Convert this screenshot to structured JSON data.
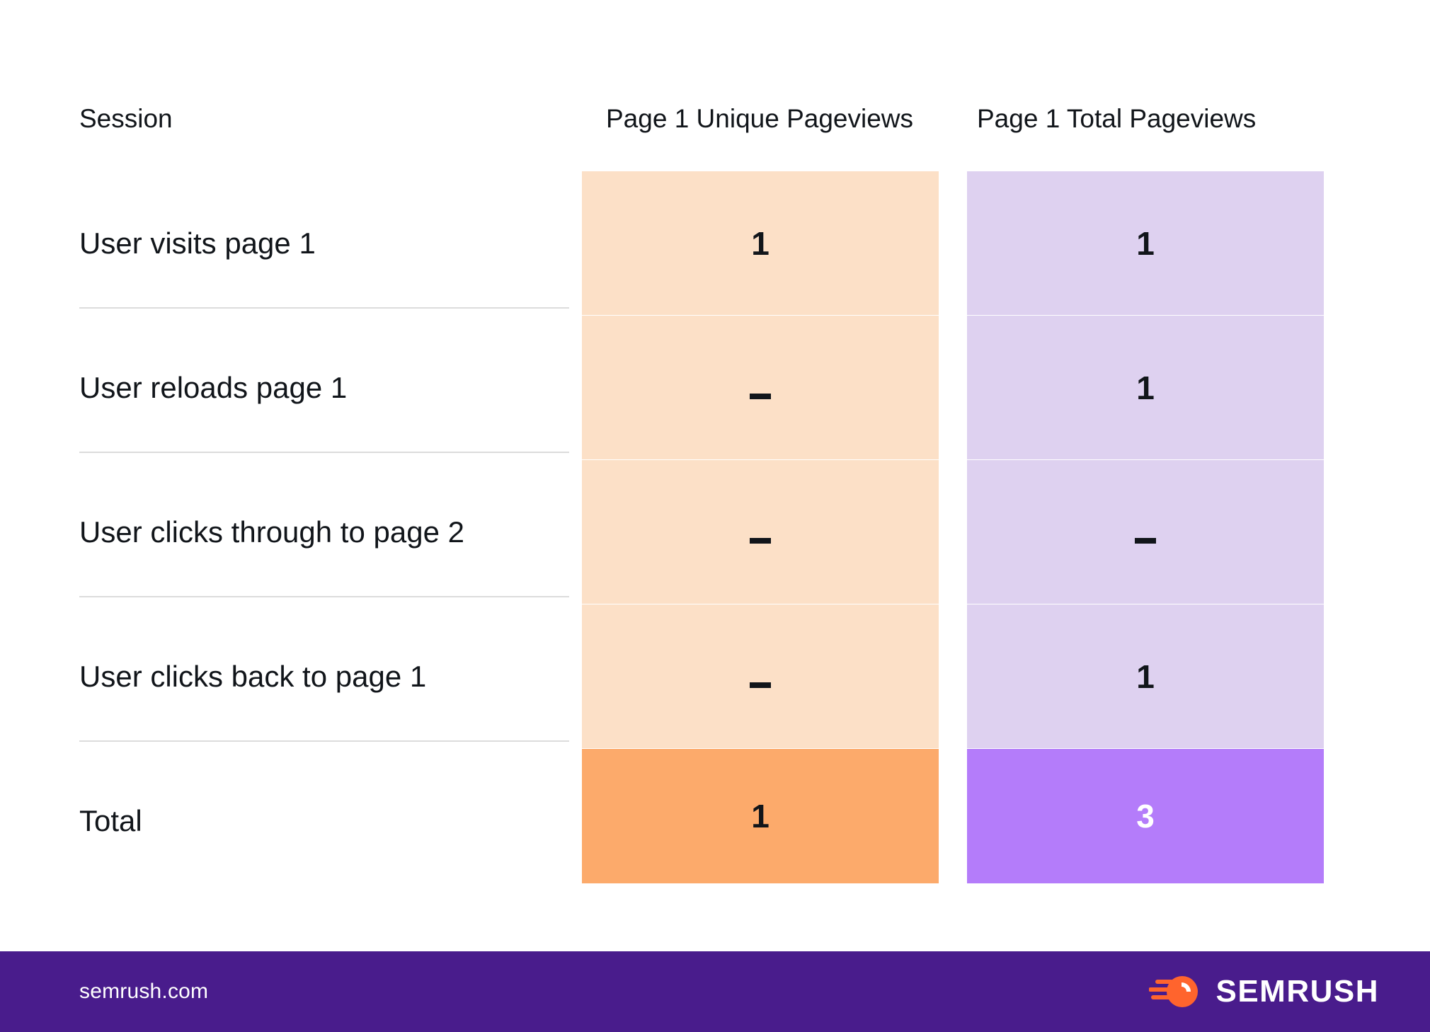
{
  "table": {
    "columns": [
      {
        "key": "session",
        "label": "Session"
      },
      {
        "key": "unique",
        "label": "Page 1 Unique Pageviews"
      },
      {
        "key": "total",
        "label": "Page 1 Total Pageviews"
      }
    ],
    "rows": [
      {
        "session": "User visits page 1",
        "unique": "1",
        "total": "1",
        "is_total": false
      },
      {
        "session": "User reloads page 1",
        "unique": "–",
        "total": "1",
        "is_total": false
      },
      {
        "session": "User clicks through to page 2",
        "unique": "–",
        "total": "–",
        "is_total": false
      },
      {
        "session": "User clicks back to page 1",
        "unique": "–",
        "total": "1",
        "is_total": false
      },
      {
        "session": "Total",
        "unique": "1",
        "total": "3",
        "is_total": true
      }
    ]
  },
  "colors": {
    "unique_light": "#fce0c7",
    "unique_total": "#fcaa6b",
    "total_light": "#ded1f0",
    "total_total": "#b47cfa",
    "footer_bg": "#491c8c",
    "logo_orange": "#ff642d",
    "divider": "#dcdcdc",
    "text": "#11151a"
  },
  "footer": {
    "url": "semrush.com",
    "brand": "SEMRUSH",
    "logo_icon": "semrush-comet-icon"
  }
}
